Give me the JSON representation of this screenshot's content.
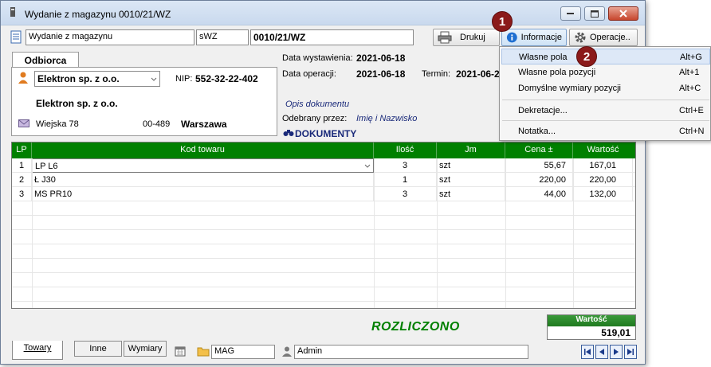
{
  "window": {
    "title": "Wydanie z magazynu 0010/21/WZ"
  },
  "toolbar": {
    "doc_type": "Wydanie z magazynu",
    "series": "sWZ",
    "doc_number": "0010/21/WZ",
    "print_label": "Drukuj",
    "info_label": "Informacje",
    "operations_label": "Operacje.."
  },
  "recipient": {
    "tab_label": "Odbiorca",
    "name_select": "Elektron sp. z o.o.",
    "nip_label": "NIP:",
    "nip_value": "552-32-22-402",
    "full_name": "Elektron sp. z o.o.",
    "street": "Wiejska 78",
    "postcode": "00-489",
    "city": "Warszawa"
  },
  "details": {
    "issue_date_label": "Data wystawienia:",
    "issue_date": "2021-06-18",
    "operation_date_label": "Data operacji:",
    "operation_date": "2021-06-18",
    "term_label": "Termin:",
    "term_value": "2021-06-2",
    "description_placeholder": "Opis dokumentu",
    "received_label": "Odebrany przez:",
    "received_placeholder": "Imię i Nazwisko",
    "documents_label": "DOKUMENTY"
  },
  "grid": {
    "headers": [
      "LP",
      "Kod towaru",
      "Ilość",
      "Jm",
      "Cena ±",
      "Wartość"
    ],
    "rows": [
      {
        "lp": "1",
        "code": "LP L6",
        "qty": "3",
        "unit": "szt",
        "price": "55,67",
        "value": "167,01"
      },
      {
        "lp": "2",
        "code": "Ł J30",
        "qty": "1",
        "unit": "szt",
        "price": "220,00",
        "value": "220,00"
      },
      {
        "lp": "3",
        "code": "MS PR10",
        "qty": "3",
        "unit": "szt",
        "price": "44,00",
        "value": "132,00"
      }
    ]
  },
  "footer": {
    "status": "ROZLICZONO",
    "total_label": "Wartość",
    "total_value": "519,01",
    "warehouse": "MAG",
    "user": "Admin"
  },
  "tabs": [
    "Towary",
    "Inne",
    "Wymiary"
  ],
  "menu": {
    "items": [
      {
        "label": "Własne pola",
        "shortcut": "Alt+G"
      },
      {
        "label": "Własne pola pozycji",
        "shortcut": "Alt+1"
      },
      {
        "label": "Domyślne wymiary pozycji",
        "shortcut": "Alt+C"
      },
      {
        "label": "Dekretacje...",
        "shortcut": "Ctrl+E"
      },
      {
        "label": "Notatka...",
        "shortcut": "Ctrl+N"
      }
    ]
  },
  "badges": [
    "1",
    "2"
  ],
  "colors": {
    "grid_header": "#008000",
    "status": "#008000",
    "badge": "#8b1a1a",
    "info": "#1f6fd1"
  },
  "icons": [
    "document-icon",
    "printer-icon",
    "info-icon",
    "gear-icon",
    "person-icon",
    "envelope-icon",
    "binoculars-icon",
    "calendar-icon",
    "folder-icon",
    "user-icon",
    "dropdown-arrow-icon"
  ]
}
